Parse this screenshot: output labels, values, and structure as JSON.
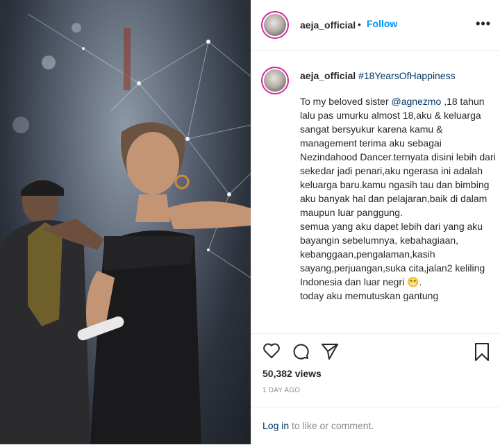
{
  "post": {
    "username": "aeja_official",
    "separator": "•",
    "follow_label": "Follow",
    "more_label": "•••",
    "hashtag": "#18YearsOfHappiness",
    "caption_prefix": "To my beloved sister ",
    "mention": "@agnezmo",
    "caption_rest": " ,18 tahun lalu pas umurku almost 18,aku & keluarga sangat bersyukur karena kamu & management terima aku sebagai Nezindahood Dancer.ternyata disini lebih dari sekedar jadi penari,aku ngerasa ini adalah keluarga baru.kamu ngasih tau dan bimbing aku banyak hal dan pelajaran,baik di dalam maupun luar panggung.\nsemua yang aku dapet lebih dari yang aku bayangin sebelumnya, kebahagiaan, kebanggaan,pengalaman,kasih sayang,perjuangan,suka cita,jalan2 keliling Indonesia dan luar negri 😁.\ntoday aku memutuskan gantung",
    "views": "50,382 views",
    "time_ago": "1 DAY AGO",
    "login_link": "Log in",
    "login_rest": " to like or comment."
  },
  "icons": {
    "like": "heart-icon",
    "comment": "comment-icon",
    "share": "paper-plane-icon",
    "save": "bookmark-icon",
    "more": "more-options-icon"
  },
  "colors": {
    "link": "#0095f6",
    "hashtag": "#00376b",
    "avatar_ring": "#d6249f",
    "muted": "#8e8e8e"
  }
}
